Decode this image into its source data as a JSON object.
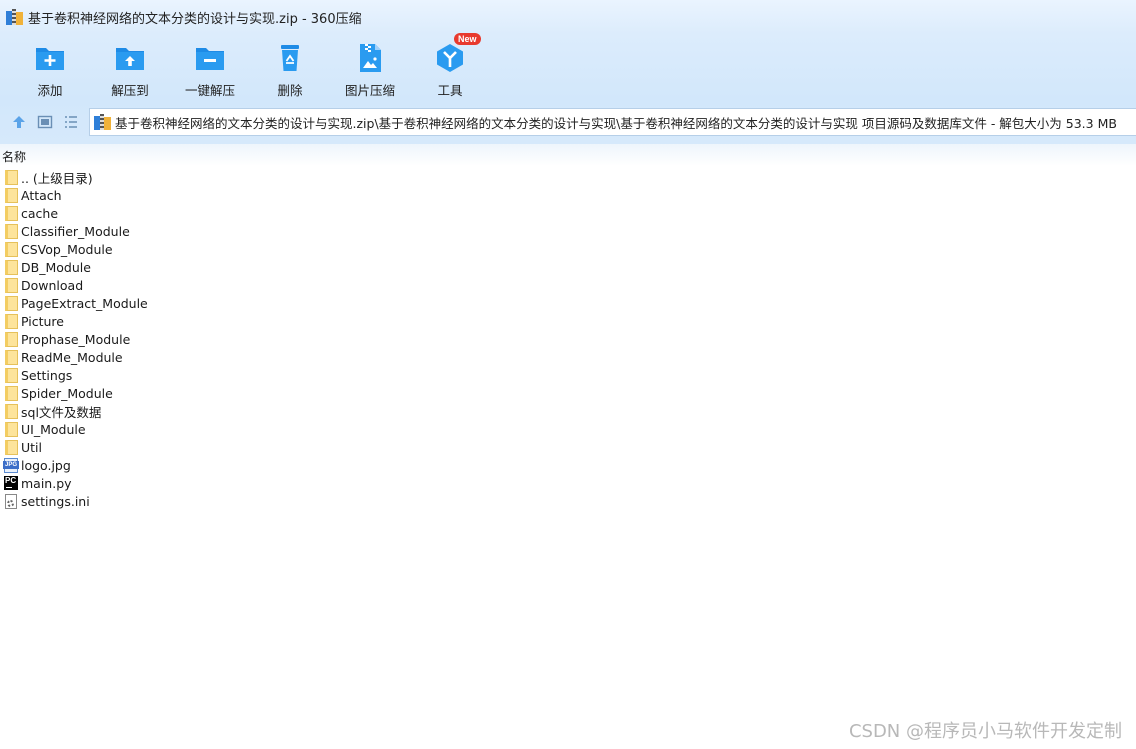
{
  "window": {
    "title": "基于卷积神经网络的文本分类的设计与实现.zip - 360压缩"
  },
  "toolbar": {
    "items": [
      {
        "label": "添加",
        "icon": "add-folder-icon"
      },
      {
        "label": "解压到",
        "icon": "extract-to-icon"
      },
      {
        "label": "一键解压",
        "icon": "one-click-extract-icon"
      },
      {
        "label": "删除",
        "icon": "recycle-bin-icon"
      },
      {
        "label": "图片压缩",
        "icon": "image-compress-icon"
      },
      {
        "label": "工具",
        "icon": "tools-icon",
        "badge": "New"
      }
    ]
  },
  "nav": {
    "path": "基于卷积神经网络的文本分类的设计与实现.zip\\基于卷积神经网络的文本分类的设计与实现\\基于卷积神经网络的文本分类的设计与实现 项目源码及数据库文件 - 解包大小为 53.3 MB"
  },
  "list": {
    "column_name": "名称",
    "items": [
      {
        "name": ".. (上级目录)",
        "type": "folder"
      },
      {
        "name": "Attach",
        "type": "folder"
      },
      {
        "name": "cache",
        "type": "folder"
      },
      {
        "name": "Classifier_Module",
        "type": "folder"
      },
      {
        "name": "CSVop_Module",
        "type": "folder"
      },
      {
        "name": "DB_Module",
        "type": "folder"
      },
      {
        "name": "Download",
        "type": "folder"
      },
      {
        "name": "PageExtract_Module",
        "type": "folder"
      },
      {
        "name": "Picture",
        "type": "folder"
      },
      {
        "name": "Prophase_Module",
        "type": "folder"
      },
      {
        "name": "ReadMe_Module",
        "type": "folder"
      },
      {
        "name": "Settings",
        "type": "folder"
      },
      {
        "name": "Spider_Module",
        "type": "folder"
      },
      {
        "name": "sql文件及数据",
        "type": "folder"
      },
      {
        "name": "UI_Module",
        "type": "folder"
      },
      {
        "name": "Util",
        "type": "folder"
      },
      {
        "name": "logo.jpg",
        "type": "jpg"
      },
      {
        "name": "main.py",
        "type": "py"
      },
      {
        "name": "settings.ini",
        "type": "ini"
      }
    ]
  },
  "watermark": "CSDN @程序员小马软件开发定制",
  "colors": {
    "accent": "#1e8be6",
    "toolbar_bg": "#d6e9fb",
    "folder": "#fde49b",
    "badge": "#e83a2e"
  }
}
